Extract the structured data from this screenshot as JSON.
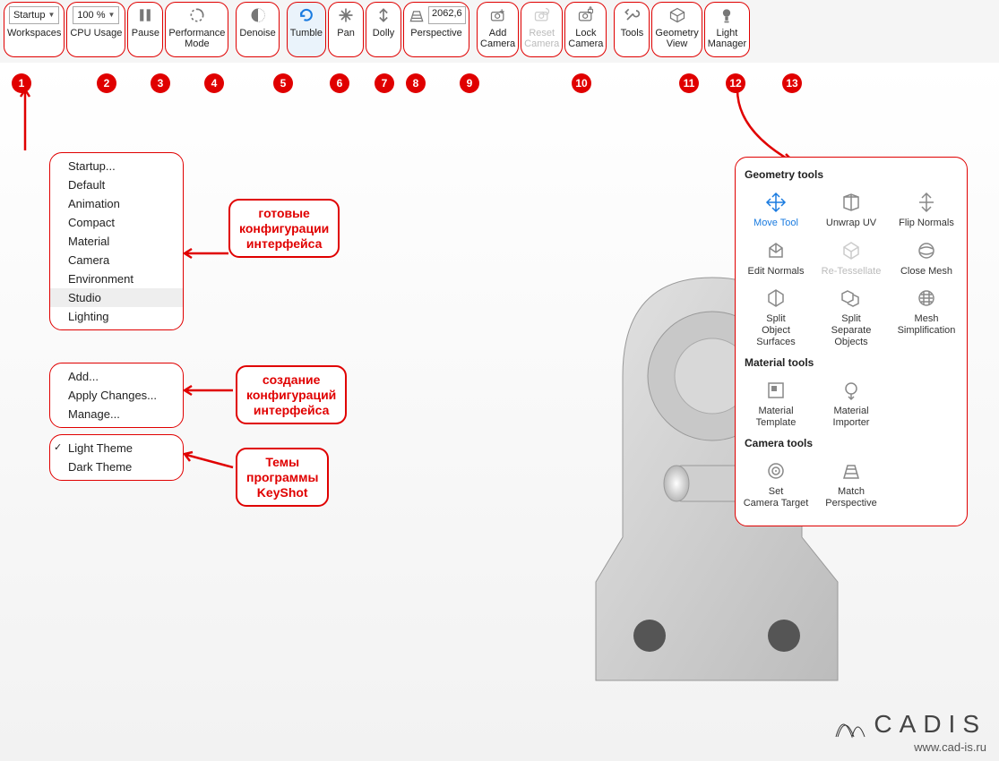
{
  "toolbar": {
    "workspaces": {
      "value": "Startup",
      "label": "Workspaces"
    },
    "cpu": {
      "value": "100 %",
      "label": "CPU Usage"
    },
    "pause": {
      "label": "Pause"
    },
    "perf": {
      "label1": "Performance",
      "label2": "Mode"
    },
    "denoise": {
      "label": "Denoise"
    },
    "tumble": {
      "label": "Tumble"
    },
    "pan": {
      "label": "Pan"
    },
    "dolly": {
      "label": "Dolly"
    },
    "persp": {
      "label": "Perspective",
      "value": "2062,6"
    },
    "addcam": {
      "label1": "Add",
      "label2": "Camera"
    },
    "resetcam": {
      "label1": "Reset",
      "label2": "Camera"
    },
    "lockcam": {
      "label1": "Lock",
      "label2": "Camera"
    },
    "tools": {
      "label": "Tools"
    },
    "geom": {
      "label1": "Geometry",
      "label2": "View"
    },
    "light": {
      "label1": "Light",
      "label2": "Manager"
    }
  },
  "numbers": [
    "1",
    "2",
    "3",
    "4",
    "5",
    "6",
    "7",
    "8",
    "9",
    "10",
    "11",
    "12",
    "13"
  ],
  "menu": {
    "block1": [
      "Startup...",
      "Default",
      "Animation",
      "Compact",
      "Material",
      "Camera",
      "Environment",
      "Studio",
      "Lighting"
    ],
    "block1_sel_index": 7,
    "block2": [
      "Add...",
      "Apply Changes...",
      "Manage..."
    ],
    "block3": [
      "Light Theme",
      "Dark Theme"
    ],
    "block3_checked_index": 0
  },
  "callouts": {
    "c1": {
      "l1": "готовые",
      "l2": "конфигурации",
      "l3": "интерфейса"
    },
    "c2": {
      "l1": "создание",
      "l2": "конфигураций",
      "l3": "интерфейса"
    },
    "c3": {
      "l1": "Темы",
      "l2": "программы",
      "l3": "KeyShot"
    }
  },
  "tools_panel": {
    "geom_title": "Geometry tools",
    "geom": [
      {
        "name": "Move Tool",
        "active": true
      },
      {
        "name": "Unwrap UV"
      },
      {
        "name": "Flip Normals"
      },
      {
        "name": "Edit Normals"
      },
      {
        "name": "Re-Tessellate",
        "dim": true
      },
      {
        "name": "Close Mesh"
      },
      {
        "name": "Split Object Surfaces",
        "two": true
      },
      {
        "name": "Split Separate Objects",
        "three": true
      },
      {
        "name": "Mesh Simplification",
        "two": true
      }
    ],
    "mat_title": "Material tools",
    "mat": [
      {
        "name": "Material Template",
        "two": true
      },
      {
        "name": "Material Importer",
        "two": true
      }
    ],
    "cam_title": "Camera tools",
    "cam": [
      {
        "name": "Set Camera Target",
        "two": true
      },
      {
        "name": "Match Perspective",
        "two": true
      }
    ]
  },
  "watermark": {
    "brand": "CADIS",
    "url": "www.cad-is.ru"
  }
}
